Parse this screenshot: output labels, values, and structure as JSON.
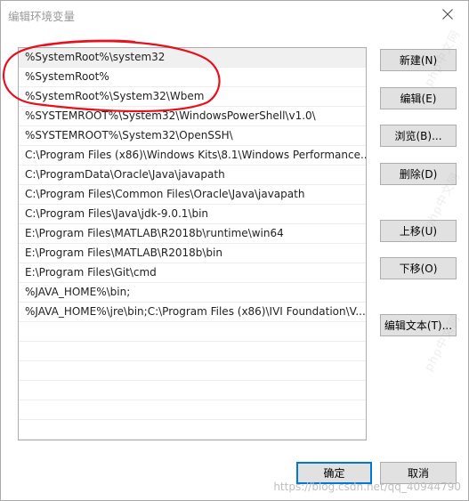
{
  "window": {
    "title": "编辑环境变量"
  },
  "paths": [
    "%SystemRoot%\\system32",
    "%SystemRoot%",
    "%SystemRoot%\\System32\\Wbem",
    "%SYSTEMROOT%\\System32\\WindowsPowerShell\\v1.0\\",
    "%SYSTEMROOT%\\System32\\OpenSSH\\",
    "C:\\Program Files (x86)\\Windows Kits\\8.1\\Windows Performance...",
    "C:\\ProgramData\\Oracle\\Java\\javapath",
    "C:\\Program Files\\Common Files\\Oracle\\Java\\javapath",
    "C:\\Program Files\\Java\\jdk-9.0.1\\bin",
    "E:\\Program Files\\MATLAB\\R2018b\\runtime\\win64",
    "E:\\Program Files\\MATLAB\\R2018b\\bin",
    "E:\\Program Files\\Git\\cmd",
    "%JAVA_HOME%\\bin;",
    "%JAVA_HOME%\\jre\\bin;C:\\Program Files (x86)\\IVI Foundation\\V..."
  ],
  "buttons": {
    "new": "新建(N)",
    "edit": "编辑(E)",
    "browse": "浏览(B)...",
    "delete": "删除(D)",
    "move_up": "上移(U)",
    "move_down": "下移(O)",
    "edit_text": "编辑文本(T)...",
    "ok": "确定",
    "cancel": "取消"
  },
  "watermark": {
    "url": "https://blog.csdn.net/qq_40944790",
    "diagonal": "php中文网"
  },
  "colors": {
    "annotation_red": "#e8101c",
    "default_button_border": "#0078d7",
    "button_face": "#e1e1e1"
  },
  "icons": {
    "close": "close-icon"
  }
}
